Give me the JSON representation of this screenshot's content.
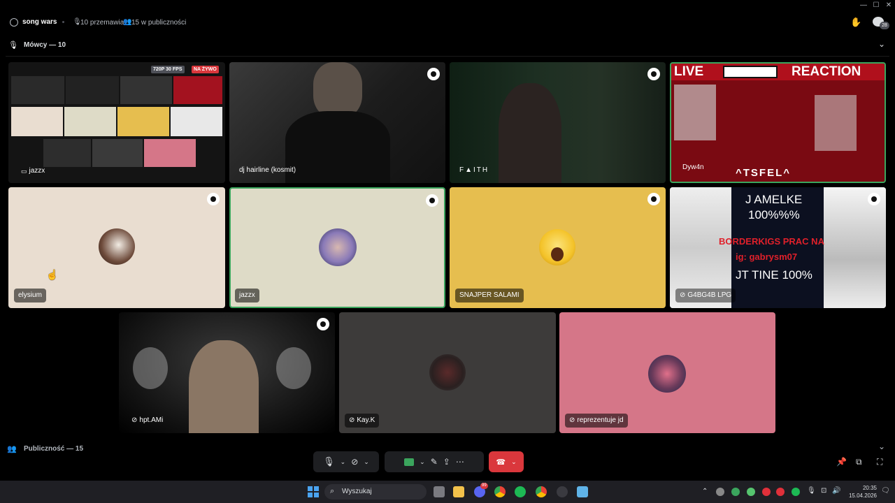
{
  "window": {
    "title": "song wars",
    "speakers_count_text": "10 przemawia",
    "audience_count_text": "15 w publiczności",
    "notification_count": "28"
  },
  "speakers_section": {
    "label": "Mówcy — 10"
  },
  "tiles": [
    {
      "name": "jazzx",
      "stream_quality": "720P 30 FPS",
      "live_badge": "NA ŻYWO"
    },
    {
      "name": "dj hairline (kosmit)"
    },
    {
      "name": "F▲ITH"
    },
    {
      "name": "Dyw4n",
      "overlay_left": "LIVE",
      "overlay_right": "REACTION",
      "overlay_bottom": "^TSFEL^"
    },
    {
      "name": "elysium"
    },
    {
      "name": "jazzx"
    },
    {
      "name": "SNAJPER SALAMI"
    },
    {
      "name": "G4BG4B LPG",
      "overlay_lines": [
        "J AMELKE",
        "100%%%",
        "BORDERKIGS PRAC NA",
        "ig: gabrysm07",
        "JT TINE 100%"
      ]
    },
    {
      "name": "hpt.AMi"
    },
    {
      "name": "Kay.K"
    },
    {
      "name": "reprezentuje jd"
    }
  ],
  "audience_section": {
    "label": "Publiczność — 15"
  },
  "taskbar": {
    "search_placeholder": "Wyszukaj",
    "time": "20:35",
    "date": "15.04.2026",
    "discord_badge": "99"
  },
  "colors": {
    "tile_elysium": "#e9ddd0",
    "tile_jazzx": "#dedbc7",
    "tile_snajper": "#e6be4f",
    "tile_reprezentuje": "#d57688",
    "tile_kay": "#3d3b3a",
    "hangup": "#da373c",
    "speaking_border": "#3ba55d"
  }
}
